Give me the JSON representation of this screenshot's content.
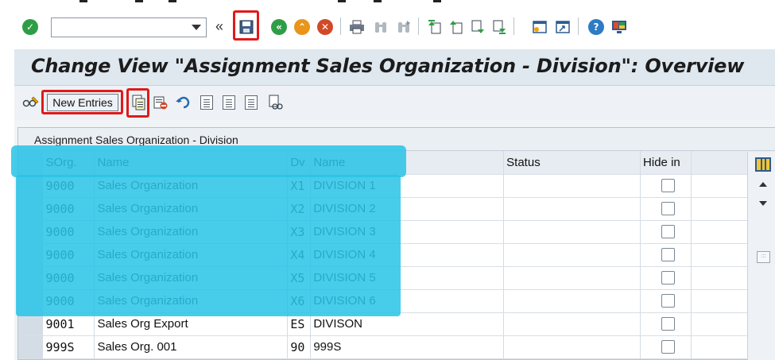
{
  "command_field": {
    "value": "",
    "placeholder": ""
  },
  "title": "Change View \"Assignment Sales Organization - Division\": Overview",
  "toolbar": {
    "new_entries_label": "New Entries"
  },
  "table": {
    "caption": "Assignment Sales Organization - Division",
    "columns": [
      "SOrg.",
      "Name",
      "Dv",
      "Name",
      "Status",
      "Hide in"
    ],
    "rows": [
      {
        "sorg": "9000",
        "sorg_name": "Sales Organization",
        "dv": "X1",
        "dv_name": "DIVISION 1",
        "status": "",
        "hide": false
      },
      {
        "sorg": "9000",
        "sorg_name": "Sales Organization",
        "dv": "X2",
        "dv_name": "DIVISION 2",
        "status": "",
        "hide": false
      },
      {
        "sorg": "9000",
        "sorg_name": "Sales Organization",
        "dv": "X3",
        "dv_name": "DIVISION 3",
        "status": "",
        "hide": false
      },
      {
        "sorg": "9000",
        "sorg_name": "Sales Organization",
        "dv": "X4",
        "dv_name": "DIVISION 4",
        "status": "",
        "hide": false
      },
      {
        "sorg": "9000",
        "sorg_name": "Sales Organization",
        "dv": "X5",
        "dv_name": "DIVISION 5",
        "status": "",
        "hide": false
      },
      {
        "sorg": "9000",
        "sorg_name": "Sales Organization",
        "dv": "X6",
        "dv_name": "DIVISION 6",
        "status": "",
        "hide": false
      },
      {
        "sorg": "9001",
        "sorg_name": "Sales Org Export",
        "dv": "ES",
        "dv_name": "DIVISON",
        "status": "",
        "hide": false
      },
      {
        "sorg": "999S",
        "sorg_name": "Sales Org. 001",
        "dv": "90",
        "dv_name": "999S",
        "status": "",
        "hide": false
      }
    ]
  },
  "icons": {
    "enter": "check-icon",
    "save": "save-icon",
    "back": "back-icon",
    "exit": "exit-icon",
    "cancel": "cancel-icon",
    "print": "print-icon",
    "find": "find-icon",
    "find_next": "find-next-icon",
    "first_page": "first-page-icon",
    "previous_page": "previous-page-icon",
    "next_page": "next-page-icon",
    "last_page": "last-page-icon",
    "new_session": "new-session-icon",
    "shortcut": "shortcut-icon",
    "help": "help-icon",
    "customize": "customize-layout-icon",
    "display_change": "display-change-icon",
    "copy_as": "copy-as-icon",
    "delete": "delete-icon",
    "undo": "undo-icon",
    "select_all": "select-all-icon",
    "select_block": "select-block-icon",
    "deselect_all": "deselect-all-icon",
    "print_view": "print-view-icon",
    "column_config": "column-settings-icon"
  },
  "colors": {
    "highlight": "#29c4e6",
    "annotation_box": "#e01a1a",
    "title_bar": "#dfe7ef"
  }
}
